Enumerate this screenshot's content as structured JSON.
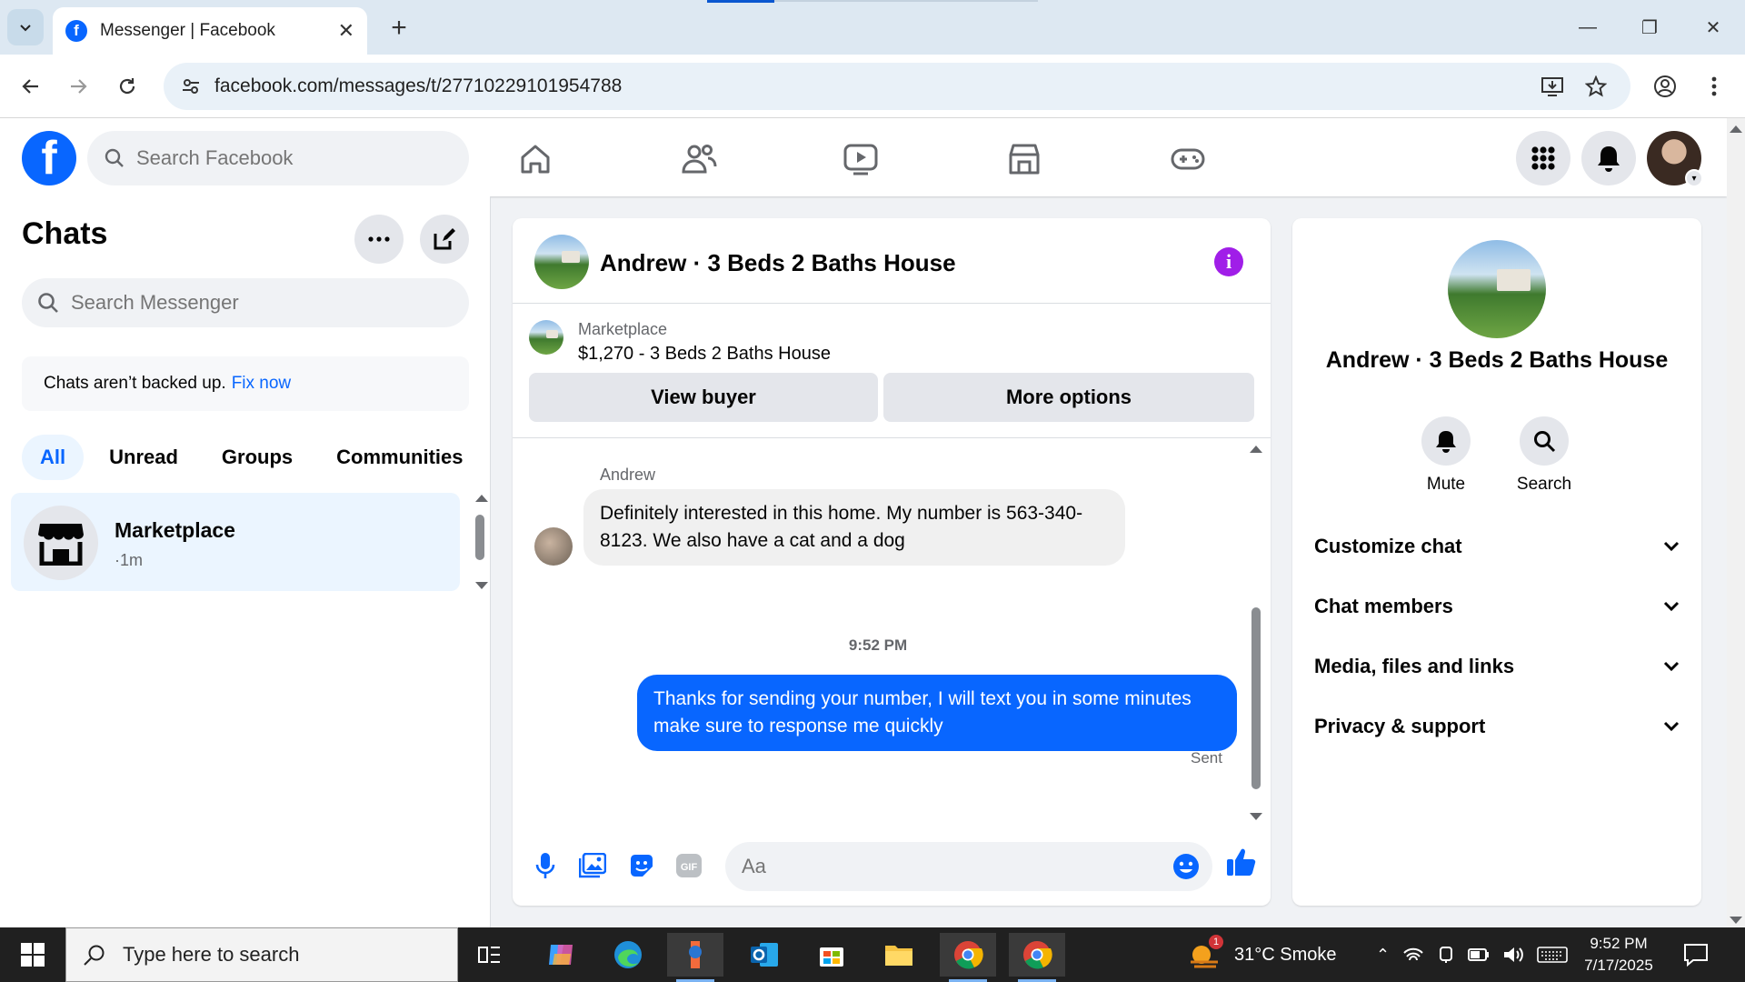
{
  "browser": {
    "tab_title": "Messenger | Facebook",
    "url": "facebook.com/messages/t/27710229101954788"
  },
  "fb_header": {
    "search_placeholder": "Search Facebook",
    "nav": [
      "home",
      "friends",
      "video",
      "marketplace",
      "gaming"
    ]
  },
  "sidebar": {
    "title": "Chats",
    "search_placeholder": "Search Messenger",
    "backup_text": "Chats aren’t backed up.",
    "backup_link": "Fix now",
    "filters": [
      "All",
      "Unread",
      "Groups",
      "Communities"
    ],
    "chats": [
      {
        "name": "Marketplace",
        "time": "·1m"
      }
    ]
  },
  "chat": {
    "title": "Andrew · 3 Beds 2 Baths House",
    "marketplace_label": "Marketplace",
    "listing": "$1,270 - 3 Beds 2 Baths House",
    "view_buyer": "View buyer",
    "more_options": "More options",
    "sender_name": "Andrew",
    "incoming_message": "Definitely interested in this home. My number is 563-340-8123. We also have a cat and a dog",
    "timestamp": "9:52 PM",
    "outgoing_message": "Thanks for sending your number, I will text you in some minutes make sure to response me quickly",
    "status": "Sent",
    "composer_placeholder": "Aa"
  },
  "info_panel": {
    "name": "Andrew · 3 Beds 2 Baths House",
    "actions": [
      "Mute",
      "Search"
    ],
    "sections": [
      "Customize chat",
      "Chat members",
      "Media, files and links",
      "Privacy & support"
    ]
  },
  "taskbar": {
    "search_placeholder": "Type here to search",
    "weather": "31°C  Smoke",
    "weather_badge": "1",
    "time": "9:52 PM",
    "date": "7/17/2025"
  },
  "colors": {
    "fb_blue": "#0866ff",
    "info_purple": "#a01ee8",
    "bubble_in": "#f0f0f0"
  }
}
